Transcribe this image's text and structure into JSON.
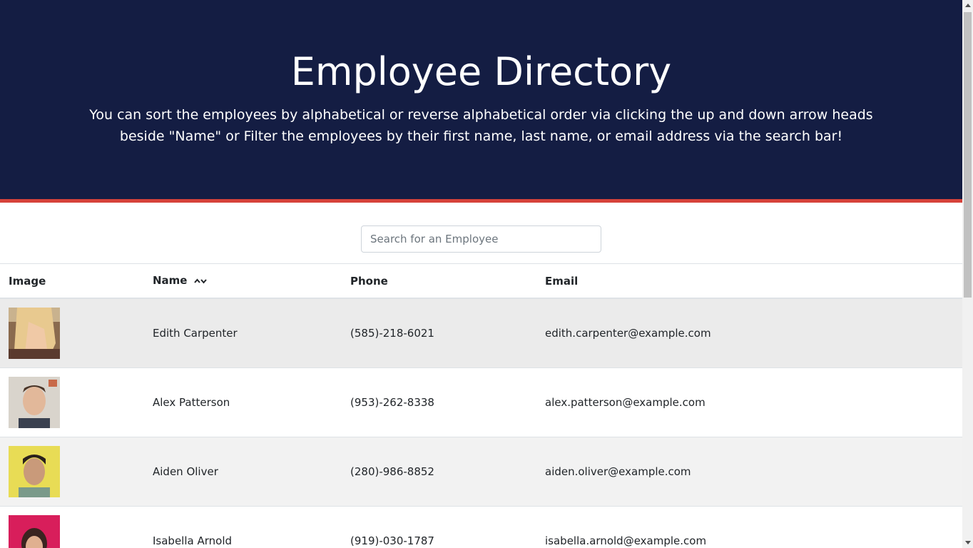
{
  "header": {
    "title": "Employee Directory",
    "subtitle": "You can sort the employees by alphabetical or reverse alphabetical order via clicking the up and down arrow heads beside \"Name\" or Filter the employees by their first name, last name, or email address via the search bar!"
  },
  "search": {
    "placeholder": "Search for an Employee",
    "value": ""
  },
  "table": {
    "columns": {
      "image": "Image",
      "name": "Name",
      "phone": "Phone",
      "email": "Email"
    },
    "rows": [
      {
        "name": "Edith Carpenter",
        "phone": "(585)-218-6021",
        "email": "edith.carpenter@example.com"
      },
      {
        "name": "Alex Patterson",
        "phone": "(953)-262-8338",
        "email": "alex.patterson@example.com"
      },
      {
        "name": "Aiden Oliver",
        "phone": "(280)-986-8852",
        "email": "aiden.oliver@example.com"
      },
      {
        "name": "Isabella Arnold",
        "phone": "(919)-030-1787",
        "email": "isabella.arnold@example.com"
      }
    ]
  },
  "colors": {
    "header_bg": "#141d43",
    "accent_border": "#d6423a"
  },
  "icons": {
    "sort_up": "chevron-up-icon",
    "sort_down": "chevron-down-icon"
  }
}
